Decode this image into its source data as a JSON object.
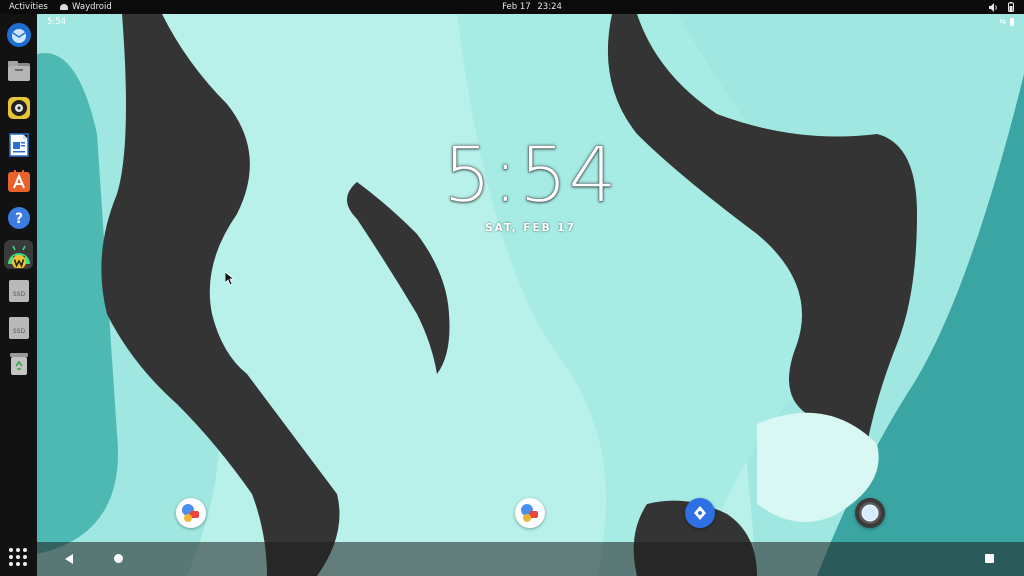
{
  "topbar": {
    "activities": "Activities",
    "app_name": "Waydroid",
    "date": "Feb 17",
    "time": "23:24",
    "icons": [
      "volume-icon",
      "battery-icon"
    ]
  },
  "dock": {
    "items": [
      {
        "name": "thunderbird",
        "icon": "thunderbird-icon"
      },
      {
        "name": "files",
        "icon": "files-icon"
      },
      {
        "name": "rhythmbox",
        "icon": "rhythmbox-icon"
      },
      {
        "name": "libreoffice-writer",
        "icon": "writer-icon"
      },
      {
        "name": "software-center",
        "icon": "software-icon"
      },
      {
        "name": "help",
        "icon": "help-icon"
      },
      {
        "name": "waydroid",
        "icon": "waydroid-icon",
        "active": true
      },
      {
        "name": "drive-1",
        "icon": "ssd-icon",
        "label": "SSD"
      },
      {
        "name": "drive-2",
        "icon": "ssd-icon",
        "label": "SSD"
      },
      {
        "name": "trash",
        "icon": "trash-icon"
      }
    ],
    "apps_button_icon": "apps-grid-icon"
  },
  "android": {
    "status_time": "5:54",
    "clock": "5:54",
    "date": "SAT, FEB 17",
    "home_icons": [
      {
        "name": "messages",
        "icon": "messages-icon"
      },
      {
        "name": "messages-2",
        "icon": "messages-icon"
      },
      {
        "name": "navigation",
        "icon": "navigation-icon"
      },
      {
        "name": "camera",
        "icon": "camera-icon"
      }
    ],
    "nav": [
      "back-icon",
      "home-icon",
      "recents-icon"
    ]
  },
  "colors": {
    "wallpaper_teal": "#9ee6df",
    "wallpaper_dark": "#333333",
    "wallpaper_deep": "#3aa5a2",
    "topbar": "#0b0b0b",
    "dock": "#121212"
  }
}
